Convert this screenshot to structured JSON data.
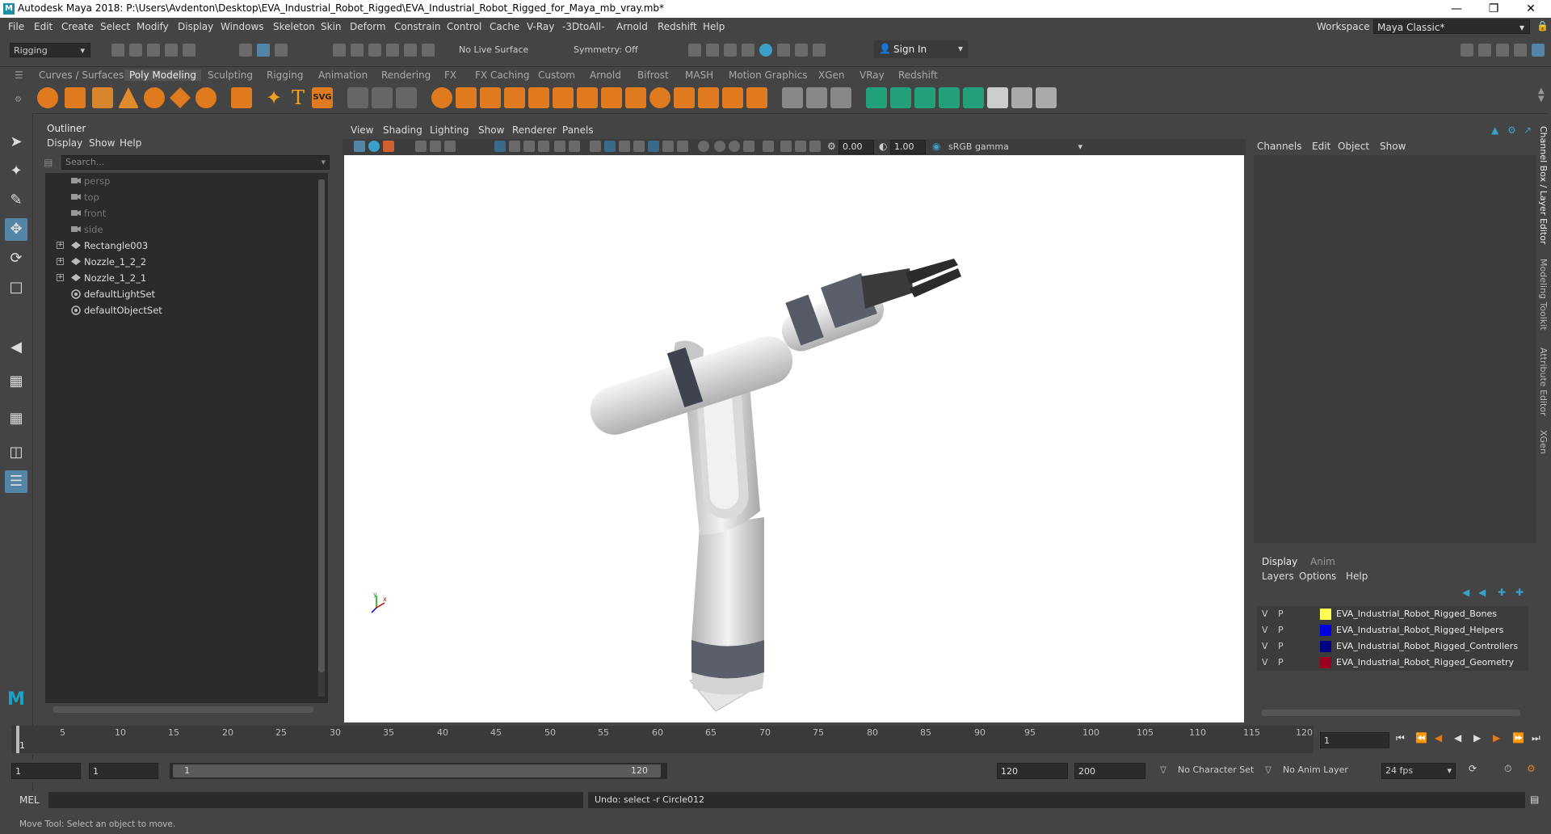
{
  "window": {
    "title": "Autodesk Maya 2018: P:\\Users\\Avdenton\\Desktop\\EVA_Industrial_Robot_Rigged\\EVA_Industrial_Robot_Rigged_for_Maya_mb_vray.mb*",
    "logo": "M"
  },
  "menubar": [
    "File",
    "Edit",
    "Create",
    "Select",
    "Modify",
    "Display",
    "Windows",
    "Skeleton",
    "Skin",
    "Deform",
    "Constrain",
    "Control",
    "Cache",
    "V-Ray",
    "-3DtoAll-",
    "Arnold",
    "Redshift",
    "Help"
  ],
  "workspace": {
    "label": "Workspace :",
    "value": "Maya Classic*"
  },
  "statusline": {
    "menuset": "Rigging",
    "live_surface": "No Live Surface",
    "symmetry": "Symmetry: Off",
    "sign_in": "Sign In"
  },
  "shelf_tabs": [
    "Curves / Surfaces",
    "Poly Modeling",
    "Sculpting",
    "Rigging",
    "Animation",
    "Rendering",
    "FX",
    "FX Caching",
    "Custom",
    "Arnold",
    "Bifrost",
    "MASH",
    "Motion Graphics",
    "XGen",
    "VRay",
    "Redshift"
  ],
  "shelf_active": "Poly Modeling",
  "outliner": {
    "title": "Outliner",
    "menu": [
      "Display",
      "Show",
      "Help"
    ],
    "search_placeholder": "Search...",
    "items": [
      {
        "label": "persp",
        "type": "camera",
        "dim": true
      },
      {
        "label": "top",
        "type": "camera",
        "dim": true
      },
      {
        "label": "front",
        "type": "camera",
        "dim": true
      },
      {
        "label": "side",
        "type": "camera",
        "dim": true
      },
      {
        "label": "Rectangle003",
        "type": "group",
        "dim": false
      },
      {
        "label": "Nozzle_1_2_2",
        "type": "group",
        "dim": false
      },
      {
        "label": "Nozzle_1_2_1",
        "type": "group",
        "dim": false
      },
      {
        "label": "defaultLightSet",
        "type": "set",
        "dim": false
      },
      {
        "label": "defaultObjectSet",
        "type": "set",
        "dim": false
      }
    ]
  },
  "viewport": {
    "menu": [
      "View",
      "Shading",
      "Lighting",
      "Show",
      "Renderer",
      "Panels"
    ],
    "exposure": "0.00",
    "gamma": "1.00",
    "color_space": "sRGB gamma"
  },
  "channelbox": {
    "menu": [
      "Channels",
      "Edit",
      "Object",
      "Show"
    ]
  },
  "layers": {
    "tabs": [
      "Display",
      "Anim"
    ],
    "menu": [
      "Layers",
      "Options",
      "Help"
    ],
    "rows": [
      {
        "v": "V",
        "p": "P",
        "color": "#ffff55",
        "name": "EVA_Industrial_Robot_Rigged_Bones"
      },
      {
        "v": "V",
        "p": "P",
        "color": "#0000e0",
        "name": "EVA_Industrial_Robot_Rigged_Helpers"
      },
      {
        "v": "V",
        "p": "P",
        "color": "#000080",
        "name": "EVA_Industrial_Robot_Rigged_Controllers"
      },
      {
        "v": "V",
        "p": "P",
        "color": "#990022",
        "name": "EVA_Industrial_Robot_Rigged_Geometry"
      }
    ]
  },
  "side_tabs": [
    "Channel Box / Layer Editor",
    "Modeling Toolkit",
    "Attribute Editor",
    "XGen"
  ],
  "timeline": {
    "ticks": [
      "1",
      "5",
      "10",
      "15",
      "20",
      "25",
      "30",
      "35",
      "40",
      "45",
      "50",
      "55",
      "60",
      "65",
      "70",
      "75",
      "80",
      "85",
      "90",
      "95",
      "100",
      "105",
      "110",
      "115",
      "120"
    ],
    "current_frame": "1"
  },
  "range": {
    "start": "1",
    "playback_start": "1",
    "slider_start": "1",
    "slider_end": "120",
    "playback_end": "120",
    "end": "200",
    "character_set": "No Character Set",
    "anim_layer": "No Anim Layer",
    "fps": "24 fps"
  },
  "cmdline": {
    "lang": "MEL",
    "result": "Undo: select -r Circle012"
  },
  "helpline": "Move Tool: Select an object to move."
}
